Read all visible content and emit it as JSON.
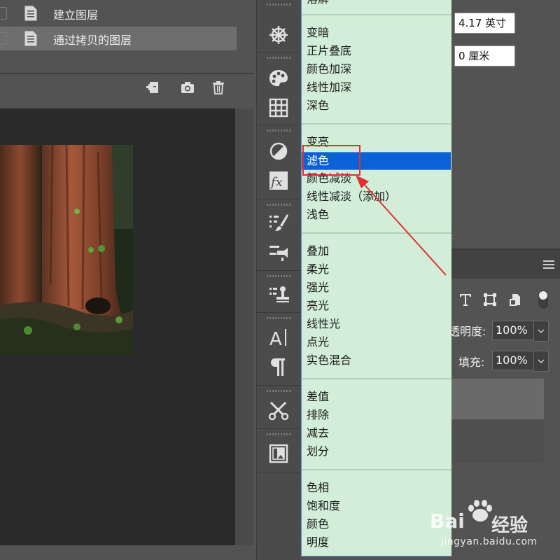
{
  "history": {
    "items": [
      {
        "label": "建立图层",
        "selected": false
      },
      {
        "label": "通过拷贝的图层",
        "selected": true
      }
    ]
  },
  "blend_menu": {
    "items": [
      "溶解",
      "变暗",
      "正片叠底",
      "颜色加深",
      "线性加深",
      "深色",
      "变亮",
      "滤色",
      "颜色减淡",
      "线性减淡（添加）",
      "浅色",
      "叠加",
      "柔光",
      "强光",
      "亮光",
      "线性光",
      "点光",
      "实色混合",
      "差值",
      "排除",
      "减去",
      "划分",
      "色相",
      "饱和度",
      "颜色",
      "明度"
    ],
    "selected": "滤色"
  },
  "properties": {
    "width_value": "4.17 英寸",
    "offset_value": "0 厘米"
  },
  "layers": {
    "opacity_label": "透明度:",
    "opacity_value": "100%",
    "fill_label": "填充:",
    "fill_value": "100%"
  },
  "watermark": {
    "brand": "Bai",
    "brand_cn": "经验",
    "url": "jingyan.baidu.com"
  },
  "colors": {
    "menu_bg": "#d3eed8",
    "selected_bg": "#0a62d6",
    "annotation": "#e03030",
    "panel_bg": "#535353"
  }
}
